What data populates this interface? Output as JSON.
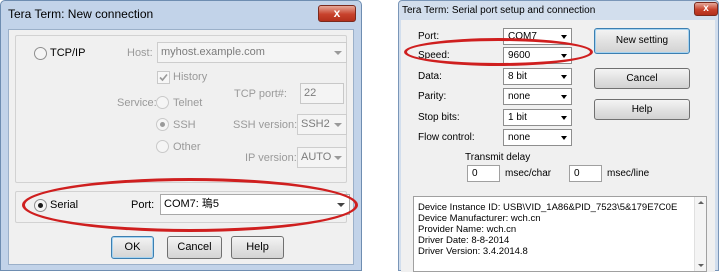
{
  "dialog1": {
    "title": "Tera Term: New connection",
    "close_glyph": "x",
    "tcpip_label": "TCP/IP",
    "host_label": "Host:",
    "host_value": "myhost.example.com",
    "history_label": "History",
    "history_checked": true,
    "service_label": "Service:",
    "telnet_label": "Telnet",
    "ssh_label": "SSH",
    "other_label": "Other",
    "tcp_port_label": "TCP port#:",
    "tcp_port_value": "22",
    "ssh_version_label": "SSH version:",
    "ssh_version_value": "SSH2",
    "ip_version_label": "IP version:",
    "ip_version_value": "AUTO",
    "serial_label": "Serial",
    "serial_selected": true,
    "port_label": "Port:",
    "port_value": "COM7: 瑦5",
    "ok_label": "OK",
    "cancel_label": "Cancel",
    "help_label": "Help"
  },
  "dialog2": {
    "title": "Tera Term: Serial port setup and connection",
    "port_label": "Port:",
    "port_value": "COM7",
    "speed_label": "Speed:",
    "speed_value": "9600",
    "data_label": "Data:",
    "data_value": "8 bit",
    "parity_label": "Parity:",
    "parity_value": "none",
    "stop_bits_label": "Stop bits:",
    "stop_bits_value": "1 bit",
    "flow_control_label": "Flow control:",
    "flow_control_value": "none",
    "new_setting_label": "New setting",
    "cancel_label": "Cancel",
    "help_label": "Help",
    "transmit_delay_label": "Transmit delay",
    "char_delay_value": "0",
    "char_delay_unit": "msec/char",
    "line_delay_value": "0",
    "line_delay_unit": "msec/line",
    "device_info": [
      "Device Instance ID: USB\\VID_1A86&PID_7523\\5&179E7C0E",
      "Device Manufacturer: wch.cn",
      "Provider Name: wch.cn",
      "Driver Date: 8-8-2014",
      "Driver Version: 3.4.2014.8"
    ]
  },
  "annotations": {
    "highlight_color": "#cf1f1f"
  }
}
